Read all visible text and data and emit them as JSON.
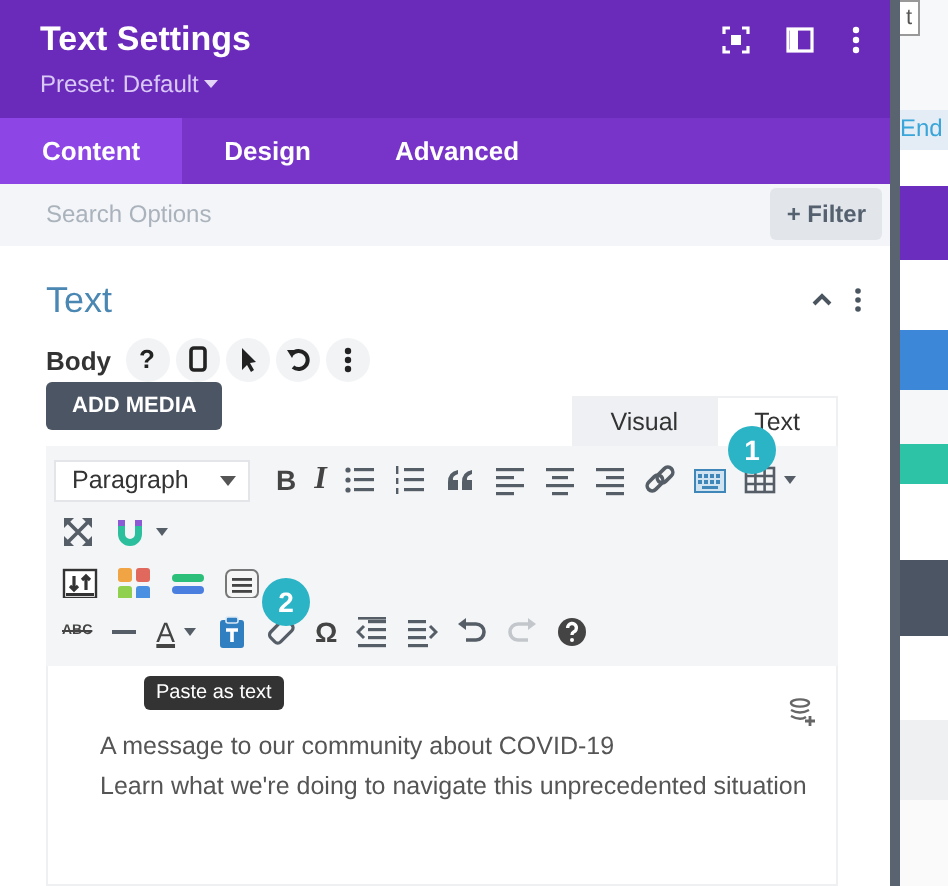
{
  "header": {
    "title": "Text Settings",
    "preset": "Preset: Default"
  },
  "tabs": [
    {
      "label": "Content",
      "selected": true
    },
    {
      "label": "Design",
      "selected": false
    },
    {
      "label": "Advanced",
      "selected": false
    }
  ],
  "search": {
    "placeholder": "Search Options",
    "filter_button": "+ Filter"
  },
  "section": {
    "title": "Text",
    "expanded": true,
    "field_label": "Body",
    "help": "?",
    "add_media": "ADD MEDIA",
    "editor_tabs": [
      {
        "label": "Visual",
        "selected": true
      },
      {
        "label": "Text",
        "selected": false
      }
    ],
    "format_select": "Paragraph",
    "toolbar_rows": [
      [
        {
          "kind": "bold",
          "label": "B"
        },
        {
          "kind": "italic",
          "label": "I"
        },
        {
          "kind": "bullets"
        },
        {
          "kind": "numbers"
        },
        {
          "kind": "quote"
        },
        {
          "kind": "align-left"
        },
        {
          "kind": "align-center"
        },
        {
          "kind": "align-right"
        },
        {
          "kind": "link"
        },
        {
          "kind": "keyboard"
        },
        {
          "kind": "table"
        },
        {
          "kind": "caret"
        }
      ],
      [
        {
          "kind": "fullscreen"
        },
        {
          "kind": "magnet"
        },
        {
          "kind": "caret"
        }
      ],
      [
        {
          "kind": "sort"
        },
        {
          "kind": "grid"
        },
        {
          "kind": "bars"
        },
        {
          "kind": "list-box"
        }
      ],
      [
        {
          "kind": "strike",
          "label": "ABC"
        },
        {
          "kind": "line"
        },
        {
          "kind": "color",
          "label": "A"
        },
        {
          "kind": "caret"
        },
        {
          "kind": "paste"
        },
        {
          "kind": "eraser"
        },
        {
          "kind": "symbol",
          "label": "Ω"
        },
        {
          "kind": "outdent"
        },
        {
          "kind": "indent"
        },
        {
          "kind": "undo"
        },
        {
          "kind": "redo"
        },
        {
          "kind": "help"
        }
      ]
    ],
    "content_lines": [
      "A message to our community about COVID-19",
      "Learn what we're doing to navigate this unprecedented situation"
    ],
    "tooltip": "Paste as text"
  },
  "callouts": [
    "1",
    "2"
  ],
  "background": {
    "buttons": [
      "t",
      "End"
    ]
  }
}
